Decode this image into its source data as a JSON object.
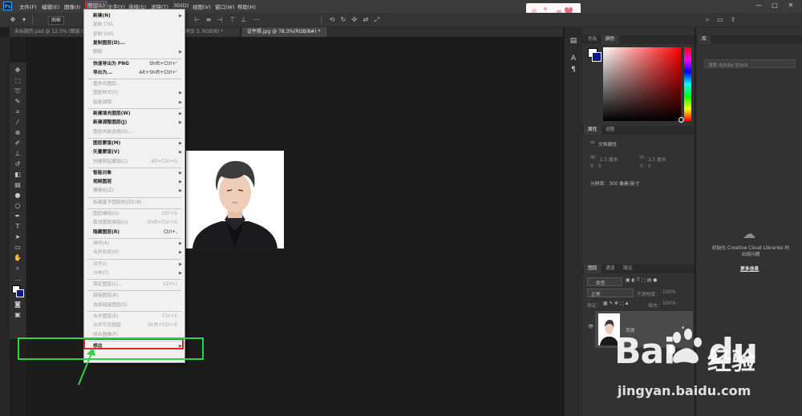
{
  "app": {
    "logo_text": "Ps"
  },
  "menubar": {
    "items": [
      "文件(F)",
      "编辑(E)",
      "图像(I)",
      "图层(L)",
      "文字(Y)",
      "选择(S)",
      "滤镜(T)",
      "3D(D)",
      "视图(V)",
      "窗口(W)",
      "帮助(H)"
    ],
    "active_index": 3,
    "window_controls": [
      "—",
      "□",
      "✕"
    ]
  },
  "options_bar": {
    "preset_label": "图框"
  },
  "tabs": [
    {
      "label": "未标题的.psd @ 12.5% (图层 0, ...",
      "active": false
    },
    {
      "label": "... 建议 3, RGB/8) *",
      "active": false
    },
    {
      "label": "证件照.jpg @ 78.3%(RGB/8#) *",
      "active": true
    }
  ],
  "layer_menu": {
    "items": [
      {
        "label": "新建(N)",
        "shortcut": "",
        "submenu": true,
        "disabled": false,
        "bold": true
      },
      {
        "label": "复制 CSS",
        "shortcut": "",
        "submenu": false,
        "disabled": true
      },
      {
        "label": "复制 SVG",
        "shortcut": "",
        "submenu": false,
        "disabled": true
      },
      {
        "label": "复制图层(D)...",
        "shortcut": "",
        "submenu": false,
        "disabled": false,
        "bold": true
      },
      {
        "label": "删除",
        "shortcut": "",
        "submenu": true,
        "disabled": true
      },
      {
        "sep": true
      },
      {
        "label": "快速导出为 PNG",
        "shortcut": "Shift+Ctrl+'",
        "submenu": false,
        "disabled": false,
        "bold": true
      },
      {
        "label": "导出为...",
        "shortcut": "Alt+Shift+Ctrl+'",
        "submenu": false,
        "disabled": false,
        "bold": true
      },
      {
        "sep": true
      },
      {
        "label": "重命名图层...",
        "shortcut": "",
        "submenu": false,
        "disabled": true
      },
      {
        "label": "图层样式(Y)",
        "shortcut": "",
        "submenu": true,
        "disabled": true
      },
      {
        "label": "智能滤镜",
        "shortcut": "",
        "submenu": true,
        "disabled": true
      },
      {
        "sep": true
      },
      {
        "label": "新建填充图层(W)",
        "shortcut": "",
        "submenu": true,
        "disabled": false,
        "bold": true
      },
      {
        "label": "新建调整图层(J)",
        "shortcut": "",
        "submenu": true,
        "disabled": false,
        "bold": true
      },
      {
        "label": "图层内容选项(O)...",
        "shortcut": "",
        "submenu": false,
        "disabled": true
      },
      {
        "sep": true
      },
      {
        "label": "图层蒙版(M)",
        "shortcut": "",
        "submenu": true,
        "disabled": false,
        "bold": true
      },
      {
        "label": "矢量蒙版(V)",
        "shortcut": "",
        "submenu": true,
        "disabled": false,
        "bold": true
      },
      {
        "label": "创建剪贴蒙版(C)",
        "shortcut": "Alt+Ctrl+G",
        "submenu": false,
        "disabled": true
      },
      {
        "sep": true
      },
      {
        "label": "智能对象",
        "shortcut": "",
        "submenu": true,
        "disabled": false,
        "bold": true
      },
      {
        "label": "视频图层",
        "shortcut": "",
        "submenu": true,
        "disabled": false,
        "bold": true
      },
      {
        "label": "栅格化(Z)",
        "shortcut": "",
        "submenu": true,
        "disabled": true
      },
      {
        "sep": true
      },
      {
        "label": "新建基于图层的切片(B)",
        "shortcut": "",
        "submenu": false,
        "disabled": true
      },
      {
        "sep": true
      },
      {
        "label": "图层编组(G)",
        "shortcut": "Ctrl+G",
        "submenu": false,
        "disabled": true
      },
      {
        "label": "取消图层编组(U)",
        "shortcut": "Shift+Ctrl+G",
        "submenu": false,
        "disabled": true
      },
      {
        "label": "隐藏图层(R)",
        "shortcut": "Ctrl+,",
        "submenu": false,
        "disabled": false,
        "bold": true
      },
      {
        "sep": true
      },
      {
        "label": "排列(A)",
        "shortcut": "",
        "submenu": true,
        "disabled": true
      },
      {
        "label": "合并形状(H)",
        "shortcut": "",
        "submenu": true,
        "disabled": true
      },
      {
        "sep": true
      },
      {
        "label": "对齐(I)",
        "shortcut": "",
        "submenu": true,
        "disabled": true
      },
      {
        "label": "分布(T)",
        "shortcut": "",
        "submenu": true,
        "disabled": true
      },
      {
        "sep": true
      },
      {
        "label": "锁定图层(L)...",
        "shortcut": "Ctrl+/",
        "submenu": false,
        "disabled": true
      },
      {
        "sep": true
      },
      {
        "label": "链接图层(K)",
        "shortcut": "",
        "submenu": false,
        "disabled": true
      },
      {
        "label": "选择链接图层(S)",
        "shortcut": "",
        "submenu": false,
        "disabled": true
      },
      {
        "sep": true
      },
      {
        "label": "合并图层(E)",
        "shortcut": "Ctrl+E",
        "submenu": false,
        "disabled": true
      },
      {
        "label": "合并可见图层",
        "shortcut": "Shift+Ctrl+E",
        "submenu": false,
        "disabled": true
      },
      {
        "label": "拼合图像(F)",
        "shortcut": "",
        "submenu": false,
        "disabled": true
      },
      {
        "sep": true
      },
      {
        "label": "修边",
        "shortcut": "",
        "submenu": true,
        "disabled": false,
        "bold": true
      }
    ]
  },
  "right_panels": {
    "color_tabs": [
      "色板",
      "颜色"
    ],
    "lib_tab": "库",
    "lib_search_placeholder": "搜索 Adobe Stock",
    "props_tabs": [
      "属性",
      "调整"
    ],
    "doc_props_label": "文档属性",
    "fields": {
      "w_label": "W:",
      "w_value": "2.5 厘米",
      "h_label": "H:",
      "h_value": "3.5 厘米",
      "x_label": "X:",
      "x_value": "0",
      "y_label": "Y:",
      "y_value": "0"
    },
    "resolution": "分辨率：300 像素/英寸",
    "lib_message": "初始化 Creative Cloud Libraries 时出现问题",
    "lib_more": "更多信息",
    "layers_tabs": [
      "图层",
      "通道",
      "路径"
    ],
    "layer_kind": "类型",
    "blend_mode": "正常",
    "opacity_label": "不透明度：",
    "opacity_value": "100%",
    "lock_label": "锁定：",
    "fill_label": "填充：",
    "fill_value": "100%",
    "layer_name": "背景"
  },
  "watermark": {
    "brand": "Bai",
    "brand2": "du",
    "cn": "经验",
    "url": "jingyan.baidu.com"
  },
  "colors": {
    "menu_highlight": "#d8282f",
    "annotation_green": "#2fd341",
    "fg_swatch": "#ffffff",
    "bg_swatch": "#0d1a8a"
  }
}
